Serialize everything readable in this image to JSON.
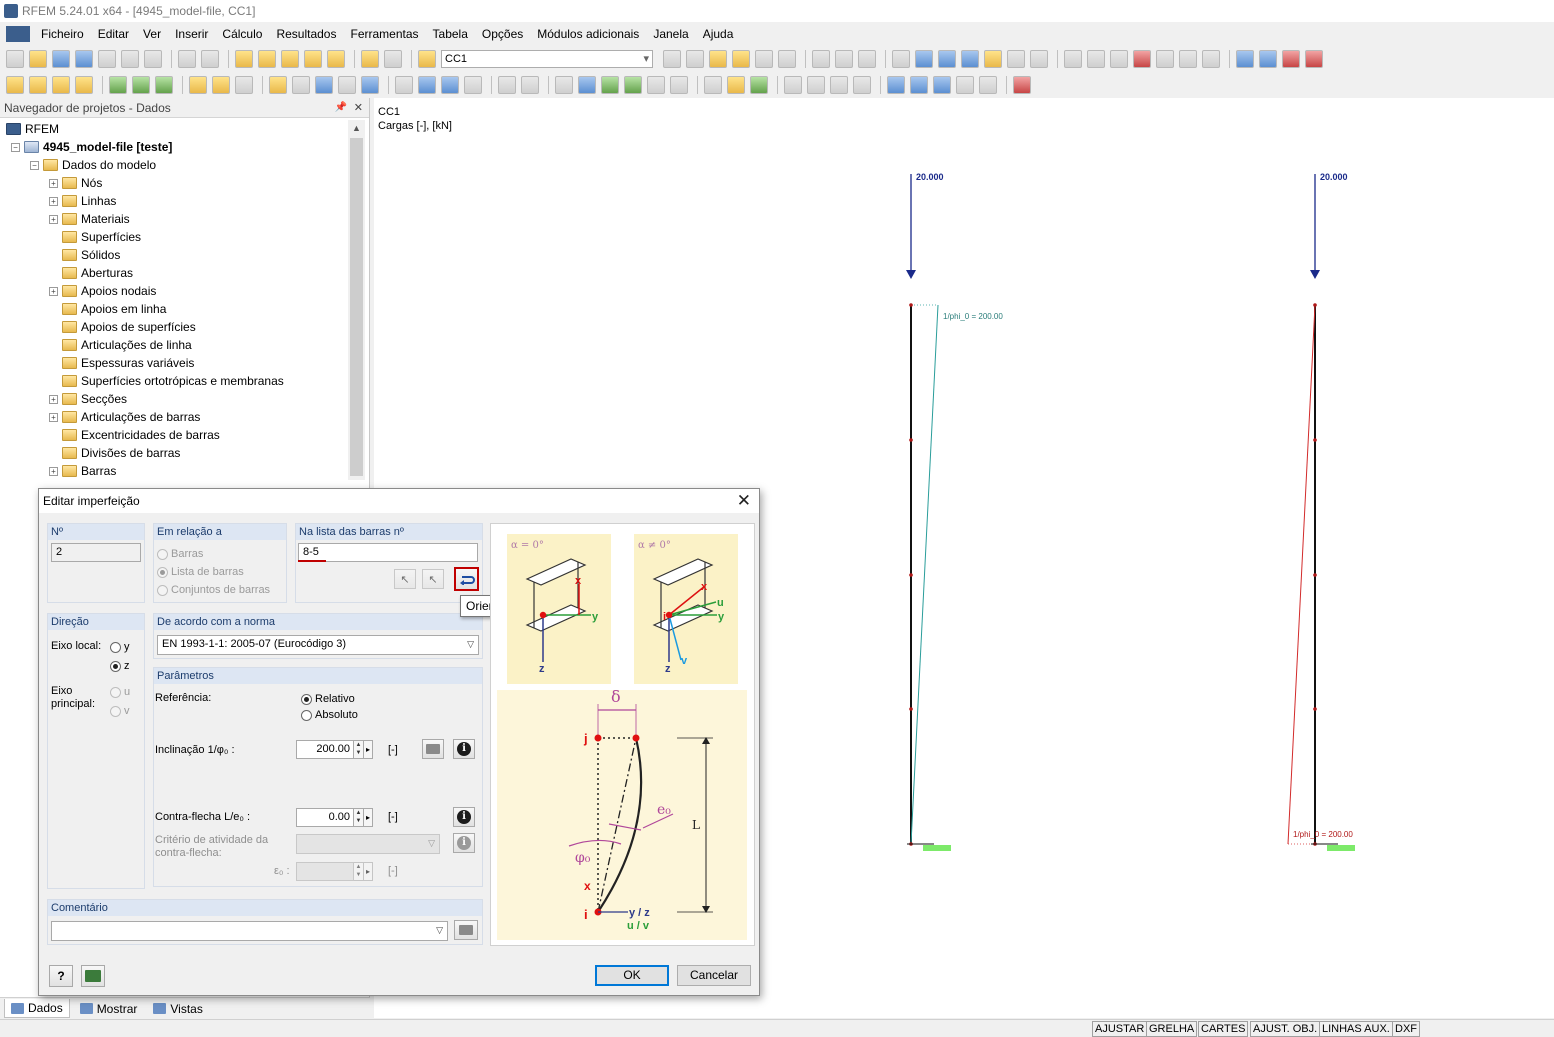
{
  "window": {
    "title": "RFEM 5.24.01 x64 - [4945_model-file, CC1]"
  },
  "menu": [
    "Ficheiro",
    "Editar",
    "Ver",
    "Inserir",
    "Cálculo",
    "Resultados",
    "Ferramentas",
    "Tabela",
    "Opções",
    "Módulos adicionais",
    "Janela",
    "Ajuda"
  ],
  "toolbar": {
    "load_case": "CC1"
  },
  "navigator": {
    "title": "Navegador de projetos - Dados",
    "root": "RFEM",
    "project": "4945_model-file [teste]",
    "model_data": "Dados do modelo",
    "items": [
      "Nós",
      "Linhas",
      "Materiais",
      "Superfícies",
      "Sólidos",
      "Aberturas",
      "Apoios nodais",
      "Apoios em linha",
      "Apoios de superfícies",
      "Articulações de linha",
      "Espessuras variáveis",
      "Superfícies ortotrópicas e membranas",
      "Secções",
      "Articulações de barras",
      "Excentricidades de barras",
      "Divisões de barras",
      "Barras"
    ],
    "tabs": {
      "data": "Dados",
      "display": "Mostrar",
      "views": "Vistas"
    }
  },
  "canvas": {
    "lc": "CC1",
    "loads_label": "Cargas [-], [kN]",
    "load_value_left": "20.000",
    "load_value_right": "20.000",
    "imperf_label_left": "1/phi_0 = 200.00",
    "imperf_label_right": "1/phi_0 = 200.00",
    "colors": {
      "left_imperf": "#2a9d9a",
      "right_imperf": "#d22b2b",
      "load": "#1a2a8a",
      "support": "#7dea6a"
    }
  },
  "dialog": {
    "title": "Editar imperfeição",
    "no_header": "Nº",
    "no_value": "2",
    "relation_header": "Em relação a",
    "rel_members": "Barras",
    "rel_member_list": "Lista de barras",
    "rel_member_sets": "Conjuntos de barras",
    "list_header": "Na lista das barras nº",
    "list_value": "8-5",
    "direction_header": "Direção",
    "local_axis_label": "Eixo local:",
    "axis_y": "y",
    "axis_z": "z",
    "principal_axis_label": "Eixo principal:",
    "axis_u": "u",
    "axis_v": "v",
    "norm_header": "De acordo com a norma",
    "norm_value": "EN 1993-1-1: 2005-07  (Eurocódigo 3)",
    "params_header": "Parâmetros",
    "reference_label": "Referência:",
    "ref_relative": "Relativo",
    "ref_absolute": "Absoluto",
    "inclination_label": "Inclinação 1/φ₀ :",
    "inclination_value": "200.00",
    "inclination_unit": "[-]",
    "precamber_label": "Contra-flecha L/e₀ :",
    "precamber_value": "0.00",
    "precamber_unit": "[-]",
    "activity_label": "Critério de atividade da contra-flecha:",
    "e0_label": "ε₀ :",
    "e0_unit": "[-]",
    "comment_header": "Comentário",
    "comment_value": "",
    "tooltip": "Orientação da barra invertida",
    "ok": "OK",
    "cancel": "Cancelar",
    "alpha_zero": "α = 0°",
    "alpha_nonzero": "α ≠ 0°",
    "delta": "δ",
    "e0_symbol": "e₀",
    "phi0_symbol": "φ₀"
  },
  "statusbar": [
    "AJUSTAR",
    "GRELHA",
    "CARTES",
    "AJUST. OBJ.",
    "LINHAS AUX.",
    "DXF"
  ]
}
